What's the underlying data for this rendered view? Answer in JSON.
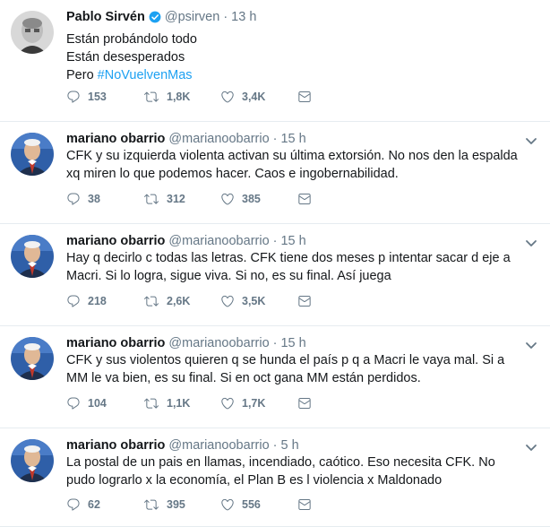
{
  "tweets": [
    {
      "name": "Pablo Sirvén",
      "verified": true,
      "handle": "@psirven",
      "time": "13 h",
      "lines": [
        "Están probándolo todo",
        "Están desesperados",
        "Pero "
      ],
      "hashtag": "#NoVuelvenMas",
      "replies": "153",
      "retweets": "1,8K",
      "likes": "3,4K"
    },
    {
      "name": "mariano obarrio",
      "verified": false,
      "handle": "@marianoobarrio",
      "time": "15 h",
      "lines": [
        "CFK y su izquierda violenta activan su última extorsión. No nos den la espalda",
        "xq miren lo que podemos hacer. Caos e ingobernabilidad."
      ],
      "replies": "38",
      "retweets": "312",
      "likes": "385"
    },
    {
      "name": "mariano obarrio",
      "verified": false,
      "handle": "@marianoobarrio",
      "time": "15 h",
      "lines": [
        "Hay q decirlo c todas las letras. CFK tiene dos meses p intentar sacar d eje a",
        "Macri. Si lo logra, sigue viva. Si no, es su final. Así juega"
      ],
      "replies": "218",
      "retweets": "2,6K",
      "likes": "3,5K"
    },
    {
      "name": "mariano obarrio",
      "verified": false,
      "handle": "@marianoobarrio",
      "time": "15 h",
      "lines": [
        "CFK y sus violentos quieren q se hunda el país p q a Macri le vaya mal. Si a",
        "MM le va bien, es su final. Si en oct gana MM están perdidos."
      ],
      "replies": "104",
      "retweets": "1,1K",
      "likes": "1,7K"
    },
    {
      "name": "mariano obarrio",
      "verified": false,
      "handle": "@marianoobarrio",
      "time": "5 h",
      "lines": [
        "La postal de un pais en llamas, incendiado, caótico. Eso necesita CFK. No",
        "pudo lograrlo x la economía, el Plan B es l violencia x Maldonado"
      ],
      "replies": "62",
      "retweets": "395",
      "likes": "556"
    }
  ],
  "colors": {
    "link": "#1da1f2",
    "meta": "#657786",
    "verified": "#1da1f2",
    "divider": "#e6ecf0"
  },
  "icons": [
    "reply-icon",
    "retweet-icon",
    "like-icon",
    "direct-message-icon",
    "caret-down-icon",
    "verified-badge-icon"
  ]
}
